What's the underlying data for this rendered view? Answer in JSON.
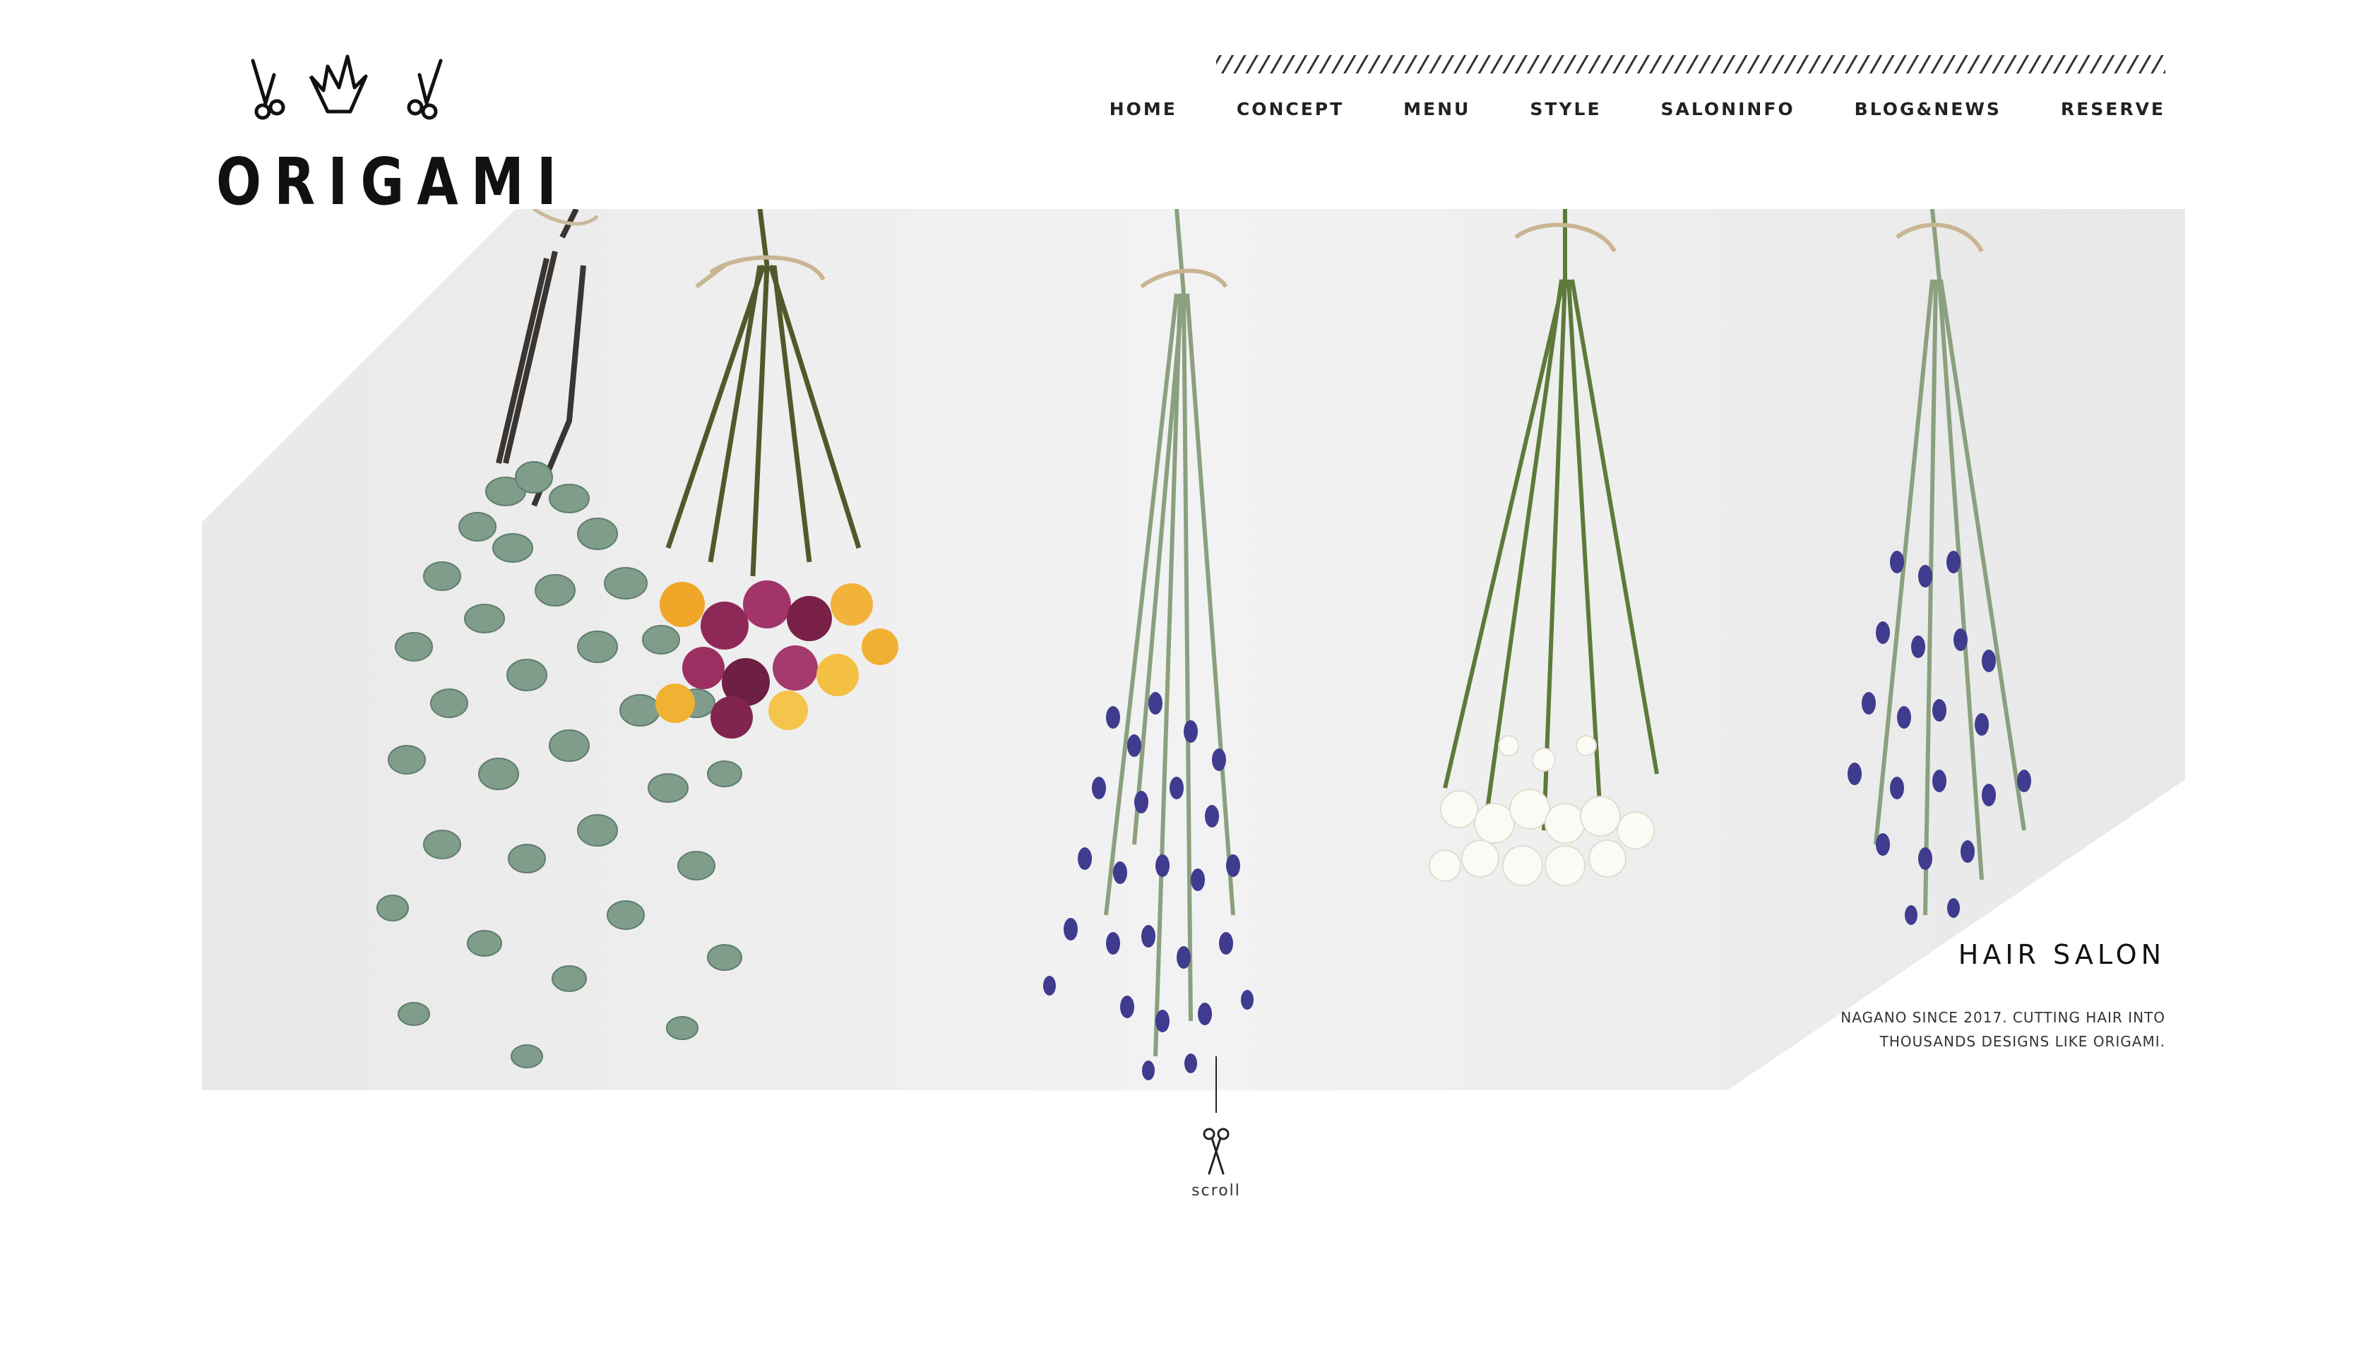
{
  "brand": {
    "logo_text": "ORIGAMI",
    "logo_icons": [
      "scissors-icon",
      "crown-icon",
      "scissors-icon"
    ]
  },
  "nav": {
    "items": [
      {
        "label": "HOME"
      },
      {
        "label": "CONCEPT"
      },
      {
        "label": "MENU"
      },
      {
        "label": "STYLE"
      },
      {
        "label": "SALONINFO"
      },
      {
        "label": "BLOG&NEWS"
      },
      {
        "label": "RESERVE"
      }
    ]
  },
  "hero": {
    "title": "HAIR SALON",
    "description": "NAGANO SINCE 2017. CUTTING HAIR INTO THOUSANDS DESIGNS LIKE ORIGAMI.",
    "image_subject": "dried flower bouquets hanging on a white wall"
  },
  "scroll": {
    "label": "scroll",
    "icon": "scissors-icon"
  },
  "colors": {
    "text": "#222222",
    "background": "#ffffff",
    "hero_wall": "#ececec",
    "lavender": "#3d3a8c",
    "eucalyptus": "#7a9a85",
    "stem_green": "#5d7a3a"
  }
}
